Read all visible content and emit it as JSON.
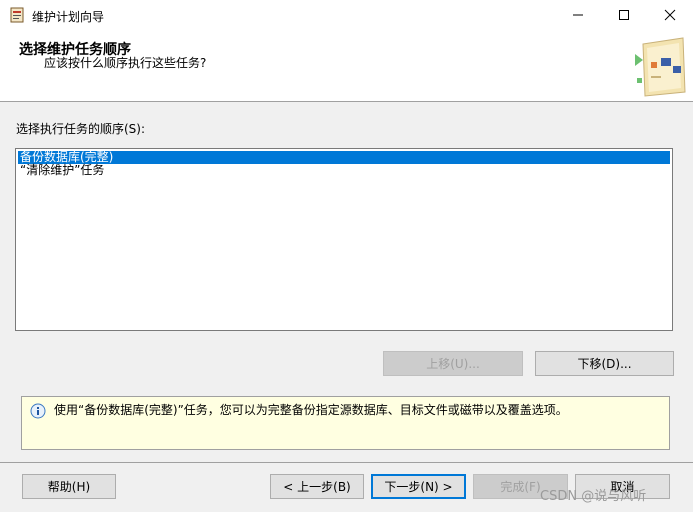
{
  "window": {
    "title": "维护计划向导",
    "minimize_glyph": "—",
    "maximize_glyph": "☐",
    "close_glyph": "✕"
  },
  "header": {
    "title": "选择维护任务顺序",
    "subtitle": "应该按什么顺序执行这些任务?"
  },
  "task_order": {
    "label": "选择执行任务的顺序(S):",
    "items": [
      {
        "text": "备份数据库(完整)",
        "selected": true
      },
      {
        "text": "“清除维护”任务",
        "selected": false
      }
    ],
    "move_up_label": "上移(U)...",
    "move_down_label": "下移(D)..."
  },
  "info": {
    "icon": "info-icon",
    "text": "使用“备份数据库(完整)”任务，您可以为完整备份指定源数据库、目标文件或磁带以及覆盖选项。"
  },
  "footer": {
    "help_label": "帮助(H)",
    "back_label": "< 上一步(B)",
    "next_label": "下一步(N) >",
    "finish_label": "完成(F)",
    "cancel_label": "取消"
  },
  "watermark": "CSDN @说与风听",
  "colors": {
    "selection": "#0078d7",
    "info_background": "#ffffe1",
    "dialog": "#f0f0f0"
  }
}
